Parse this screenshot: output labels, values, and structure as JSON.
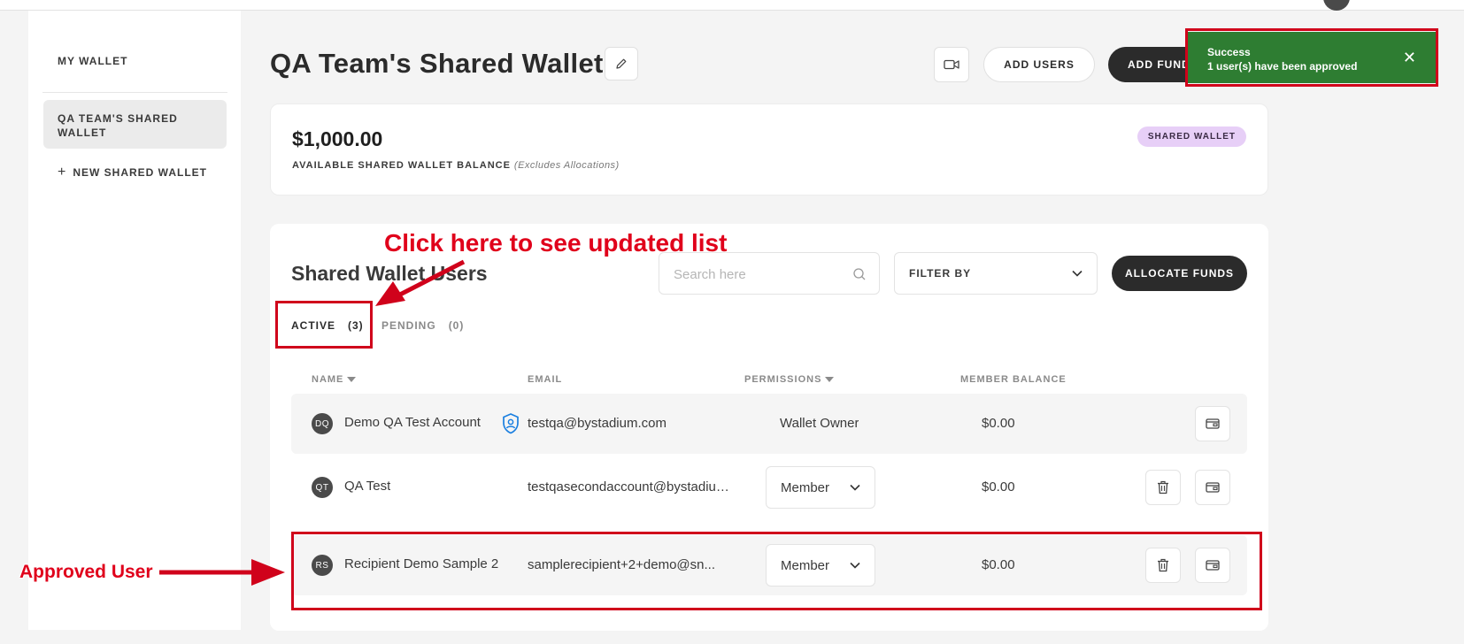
{
  "sidebar": {
    "my_wallet": "MY WALLET",
    "active_wallet": "QA TEAM'S SHARED WALLET",
    "new_wallet": "NEW SHARED WALLET"
  },
  "header": {
    "title": "QA Team's Shared Wallet",
    "add_users": "ADD USERS",
    "add_funds": "ADD FUNDS"
  },
  "balance": {
    "amount": "$1,000.00",
    "label": "AVAILABLE SHARED WALLET BALANCE",
    "note": "(Excludes Allocations)",
    "badge": "SHARED WALLET"
  },
  "users": {
    "title": "Shared Wallet Users",
    "search_placeholder": "Search here",
    "filter_label": "FILTER BY",
    "allocate": "ALLOCATE FUNDS",
    "tabs": [
      {
        "label": "ACTIVE",
        "count": "(3)"
      },
      {
        "label": "PENDING",
        "count": "(0)"
      }
    ],
    "columns": {
      "name": "NAME",
      "email": "EMAIL",
      "permissions": "PERMISSIONS",
      "balance": "MEMBER BALANCE"
    },
    "rows": [
      {
        "initials": "DQ",
        "name": "Demo QA Test Account",
        "email": "testqa@bystadium.com",
        "permission": "Wallet Owner",
        "balance": "$0.00"
      },
      {
        "initials": "QT",
        "name": "QA Test",
        "email": "testqasecondaccount@bystadium.com",
        "permission": "Member",
        "balance": "$0.00"
      },
      {
        "initials": "RS",
        "name": "Recipient Demo Sample 2",
        "email": "samplerecipient+2+demo@sn...",
        "permission": "Member",
        "balance": "$0.00"
      }
    ]
  },
  "toast": {
    "title": "Success",
    "message": "1 user(s) have been approved",
    "color": "#2e7d32"
  },
  "annotations": {
    "click_hint": "Click here to see updated list",
    "approved_user": "Approved User",
    "color": "#d0021b"
  }
}
